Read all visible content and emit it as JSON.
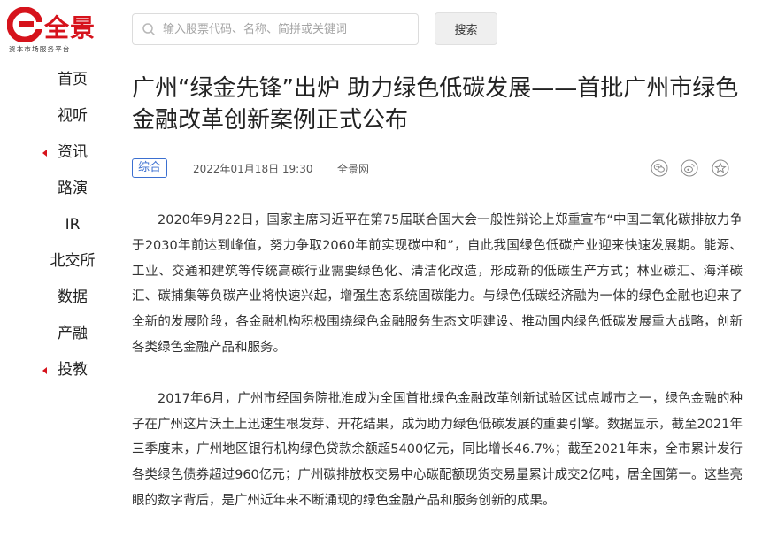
{
  "logo": {
    "brand": "全景",
    "slogan": "资本市场服务平台"
  },
  "search": {
    "placeholder": "输入股票代码、名称、简拼或关键词",
    "value": "",
    "button_label": "搜索"
  },
  "sidebar": {
    "items": [
      {
        "label": "首页",
        "marker": false
      },
      {
        "label": "视听",
        "marker": false
      },
      {
        "label": "资讯",
        "marker": true
      },
      {
        "label": "路演",
        "marker": false
      },
      {
        "label": "IR",
        "marker": false
      },
      {
        "label": "北交所",
        "marker": false
      },
      {
        "label": "数据",
        "marker": false
      },
      {
        "label": "产融",
        "marker": false
      },
      {
        "label": "投教",
        "marker": true
      }
    ]
  },
  "article": {
    "title": "广州“绿金先锋”出炉 助力绿色低碳发展——首批广州市绿色金融改革创新案例正式公布",
    "tag": "综合",
    "date": "2022年01月18日 19:30",
    "source": "全景网",
    "share_icons": [
      "wechat-icon",
      "weibo-icon",
      "star-icon"
    ],
    "paragraphs": [
      "2020年9月22日，国家主席习近平在第75届联合国大会一般性辩论上郑重宣布“中国二氧化碳排放力争于2030年前达到峰值，努力争取2060年前实现碳中和”，自此我国绿色低碳产业迎来快速发展期。能源、工业、交通和建筑等传统高碳行业需要绿色化、清洁化改造，形成新的低碳生产方式；林业碳汇、海洋碳汇、碳捕集等负碳产业将快速兴起，增强生态系统固碳能力。与绿色低碳经济融为一体的绿色金融也迎来了全新的发展阶段，各金融机构积极围绕绿色金融服务生态文明建设、推动国内绿色低碳发展重大战略，创新各类绿色金融产品和服务。",
      "2017年6月，广州市经国务院批准成为全国首批绿色金融改革创新试验区试点城市之一，绿色金融的种子在广州这片沃土上迅速生根发芽、开花结果，成为助力绿色低碳发展的重要引擎。数据显示，截至2021年三季度末，广州地区银行机构绿色贷款余额超5400亿元，同比增长46.7%；截至2021年末，全市累计发行各类绿色债券超过960亿元；广州碳排放权交易中心碳配额现货交易量累计成交2亿吨，居全国第一。这些亮眼的数字背后，是广州近年来不断涌现的绿色金融产品和服务创新的成果。"
    ]
  },
  "colors": {
    "brand_red": "#d6131c",
    "tag_blue": "#3b6fd0"
  }
}
